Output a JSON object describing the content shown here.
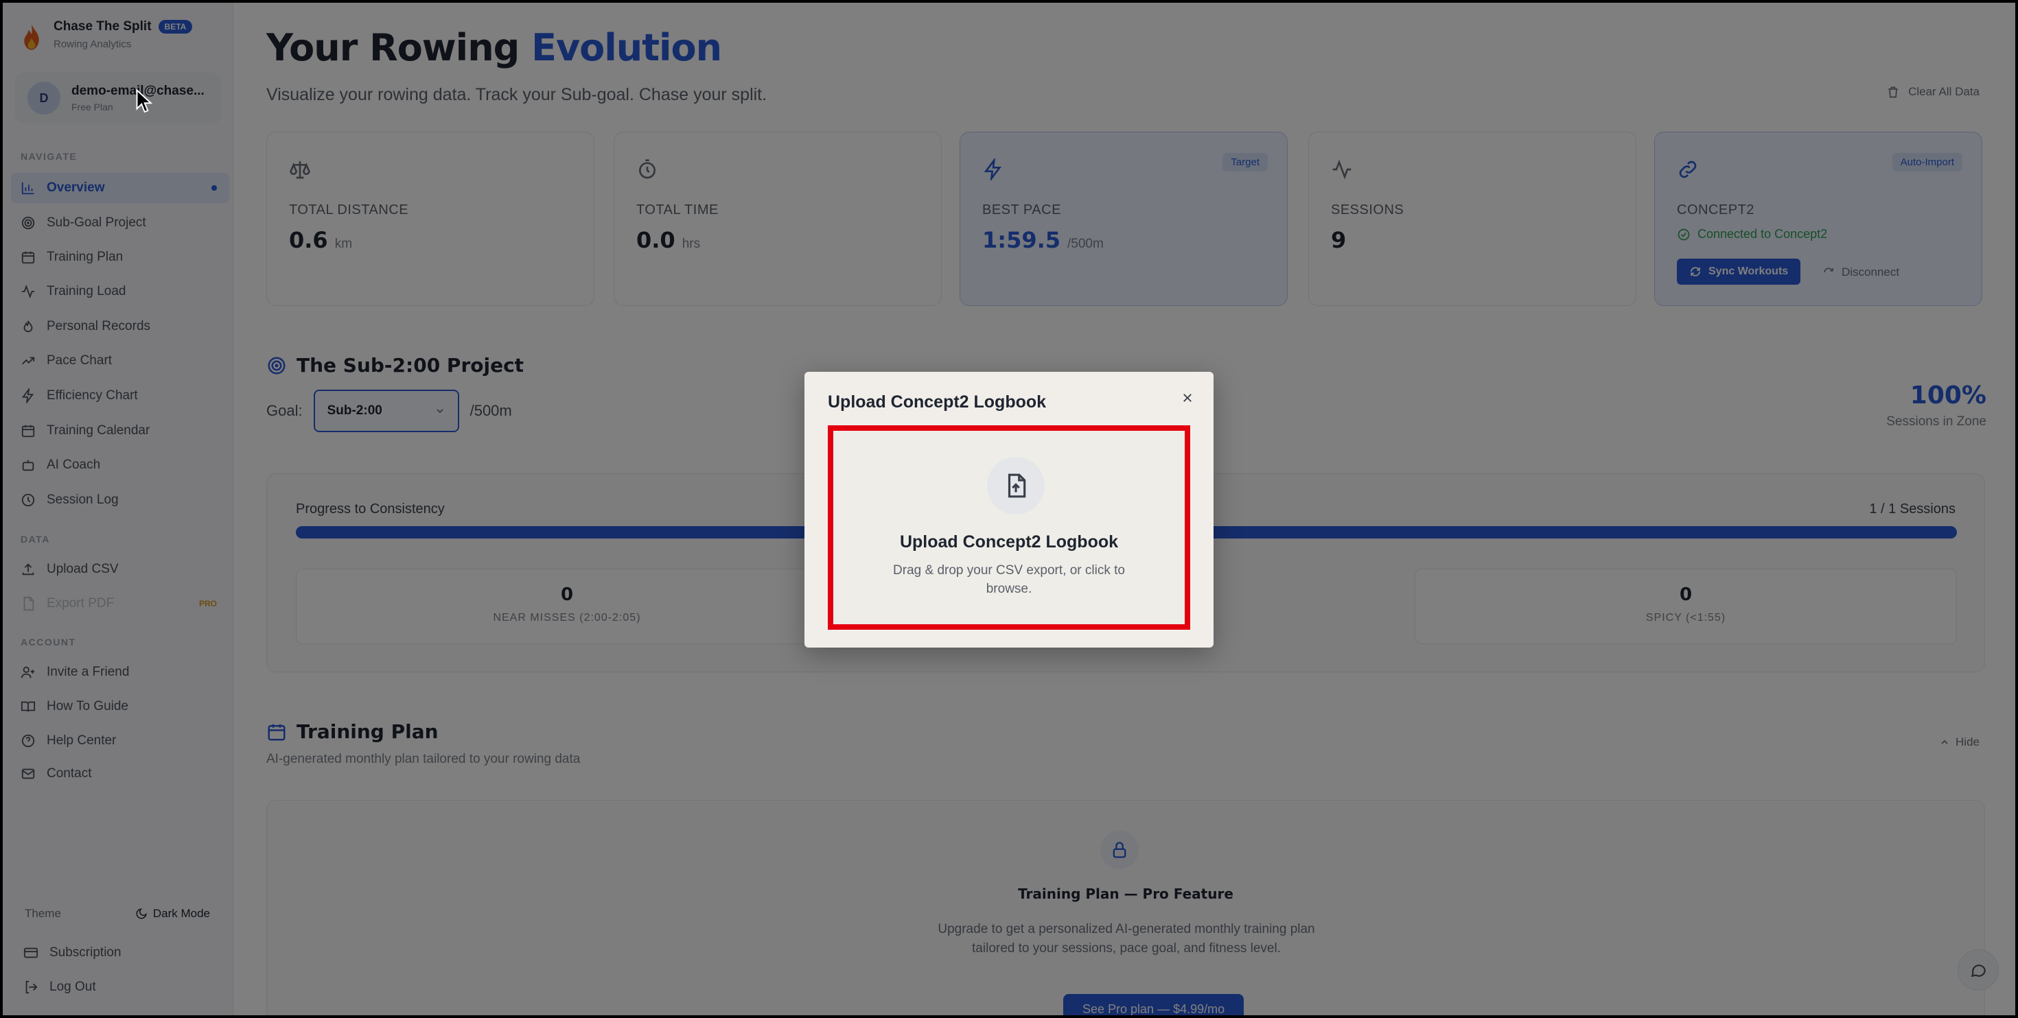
{
  "brand": {
    "name": "Chase The Split",
    "badge": "BETA",
    "subtitle": "Rowing Analytics"
  },
  "user": {
    "initial": "D",
    "email": "demo-email@chase...",
    "plan": "Free Plan"
  },
  "sidebar": {
    "navigate_label": "NAVIGATE",
    "nav": [
      {
        "label": "Overview",
        "icon": "bar-chart-icon",
        "active": true
      },
      {
        "label": "Sub-Goal Project",
        "icon": "target-icon"
      },
      {
        "label": "Training Plan",
        "icon": "calendar-icon"
      },
      {
        "label": "Training Load",
        "icon": "activity-icon"
      },
      {
        "label": "Personal Records",
        "icon": "flame-icon"
      },
      {
        "label": "Pace Chart",
        "icon": "trending-up-icon"
      },
      {
        "label": "Efficiency Chart",
        "icon": "zap-icon"
      },
      {
        "label": "Training Calendar",
        "icon": "calendar-icon"
      },
      {
        "label": "AI Coach",
        "icon": "bot-icon"
      },
      {
        "label": "Session Log",
        "icon": "clock-icon"
      }
    ],
    "data_label": "DATA",
    "data_items": [
      {
        "label": "Upload CSV",
        "icon": "upload-icon"
      },
      {
        "label": "Export PDF",
        "icon": "file-icon",
        "badge": "PRO"
      }
    ],
    "account_label": "ACCOUNT",
    "account_items": [
      {
        "label": "Invite a Friend",
        "icon": "user-plus-icon"
      },
      {
        "label": "How To Guide",
        "icon": "book-icon"
      },
      {
        "label": "Help Center",
        "icon": "help-circle-icon"
      },
      {
        "label": "Contact",
        "icon": "mail-icon"
      }
    ],
    "theme_label": "Theme",
    "theme_toggle": "Dark Mode",
    "subscription": "Subscription",
    "logout": "Log Out"
  },
  "header": {
    "title_main": "Your Rowing ",
    "title_accent": "Evolution",
    "tagline": "Visualize your rowing data. Track your Sub-goal. Chase your split.",
    "clear_label": "Clear All Data"
  },
  "cards": [
    {
      "icon": "scale-icon",
      "label": "TOTAL DISTANCE",
      "value": "0.6",
      "unit": "km"
    },
    {
      "icon": "timer-icon",
      "label": "TOTAL TIME",
      "value": "0.0",
      "unit": "hrs"
    },
    {
      "icon": "zap-icon",
      "label": "BEST PACE",
      "value": "1:59.5",
      "unit": "/500m",
      "tag": "Target"
    },
    {
      "icon": "activity-icon",
      "label": "SESSIONS",
      "value": "9"
    }
  ],
  "concept2_card": {
    "icon": "link-icon",
    "label": "CONCEPT2",
    "tag": "Auto-Import",
    "status": "Connected to Concept2",
    "sync_label": "Sync Workouts",
    "disconnect_label": "Disconnect"
  },
  "sub_project": {
    "title": "The Sub-2:00 Project",
    "goal_label": "Goal:",
    "goal_value": "Sub-2:00",
    "goal_unit": "/500m",
    "percent": "100%",
    "percent_label": "Sessions in Zone",
    "progress_label": "Progress to Consistency",
    "progress_count": "1 / 1 Sessions",
    "progress_fraction": 1.0,
    "stats": [
      {
        "value": "0",
        "label": "NEAR MISSES (2:00-2:05)"
      },
      {
        "value": "0",
        "label": "SPICY (<1:55)"
      }
    ]
  },
  "training_plan": {
    "title": "Training Plan",
    "subtitle": "AI-generated monthly plan tailored to your rowing data",
    "hide_label": "Hide",
    "locked_title": "Training Plan — Pro Feature",
    "locked_desc": "Upgrade to get a personalized AI-generated monthly training plan tailored to your sessions, pace goal, and fitness level.",
    "cta": "See Pro plan — $4.99/mo"
  },
  "modal": {
    "title": "Upload Concept2 Logbook",
    "dropzone_title": "Upload Concept2 Logbook",
    "dropzone_desc": "Drag & drop your CSV export, or click to browse.",
    "highlight_color": "#e3000f"
  }
}
